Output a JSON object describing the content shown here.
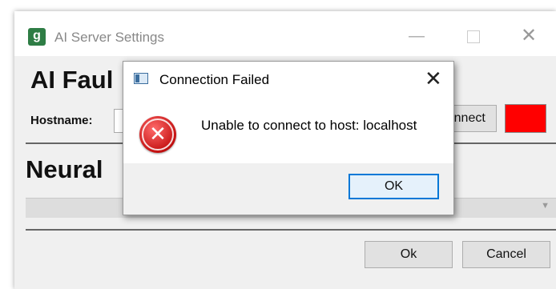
{
  "window": {
    "title": "AI Server Settings",
    "app_icon_glyph": "g",
    "minimize_glyph": "—",
    "close_glyph": "✕"
  },
  "main": {
    "header": "AI Faul",
    "hostname_label": "Hostname:",
    "connect_label": "Connect",
    "status_color": "#ff0000",
    "section_header": "Neural",
    "ok_label": "Ok",
    "cancel_label": "Cancel"
  },
  "dialog": {
    "title": "Connection Failed",
    "message": "Unable to connect to host: localhost",
    "ok_label": "OK",
    "close_glyph": "✕",
    "error_glyph": "✕",
    "icon": "error-icon"
  }
}
